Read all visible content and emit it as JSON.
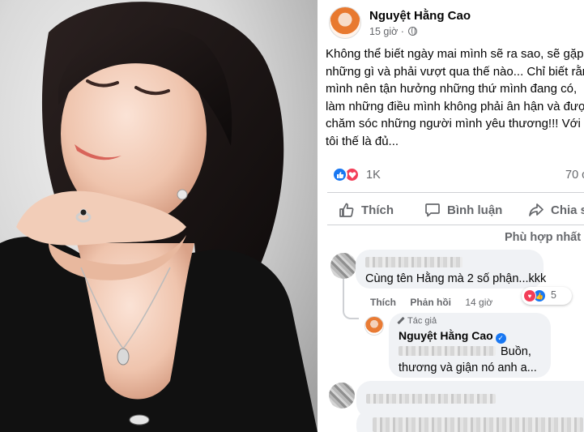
{
  "post": {
    "author": "Nguyệt Hằng Cao",
    "time": "15 giờ ·",
    "privacy_icon": "globe-icon",
    "text_lines": [
      "Không thể biết ngày mai mình sẽ ra sao, sẽ gặp",
      "những gì và phải vượt qua thế nào... Chỉ biết rằn",
      "mình nên tận hưởng những thứ mình đang có,",
      "làm những điều mình không phải ân hận và đượ",
      "chăm sóc những người mình yêu thương!!! Với",
      "tôi thế là đủ..."
    ]
  },
  "stats": {
    "reactions_count": "1K",
    "comments_count": "70 c"
  },
  "actions": {
    "like": "Thích",
    "comment": "Bình luận",
    "share": "Chia s"
  },
  "sort": {
    "label": "Phù hợp nhất"
  },
  "comments": [
    {
      "text": "Cùng tên Hằng mà 2 số phận...kkk",
      "like_label": "Thích",
      "reply_label": "Phản hồi",
      "time": "14 giờ",
      "reaction_count": "5"
    }
  ],
  "reply": {
    "badge": "Tác giả",
    "author": "Nguyệt Hằng Cao",
    "line1_visible": "Buồn,",
    "line2": "thương và giận nó anh a..."
  },
  "colors": {
    "facebook_blue": "#1877f2",
    "love_red": "#f33e58",
    "secondary_text": "#65676b",
    "bubble_bg": "#f0f2f5"
  }
}
